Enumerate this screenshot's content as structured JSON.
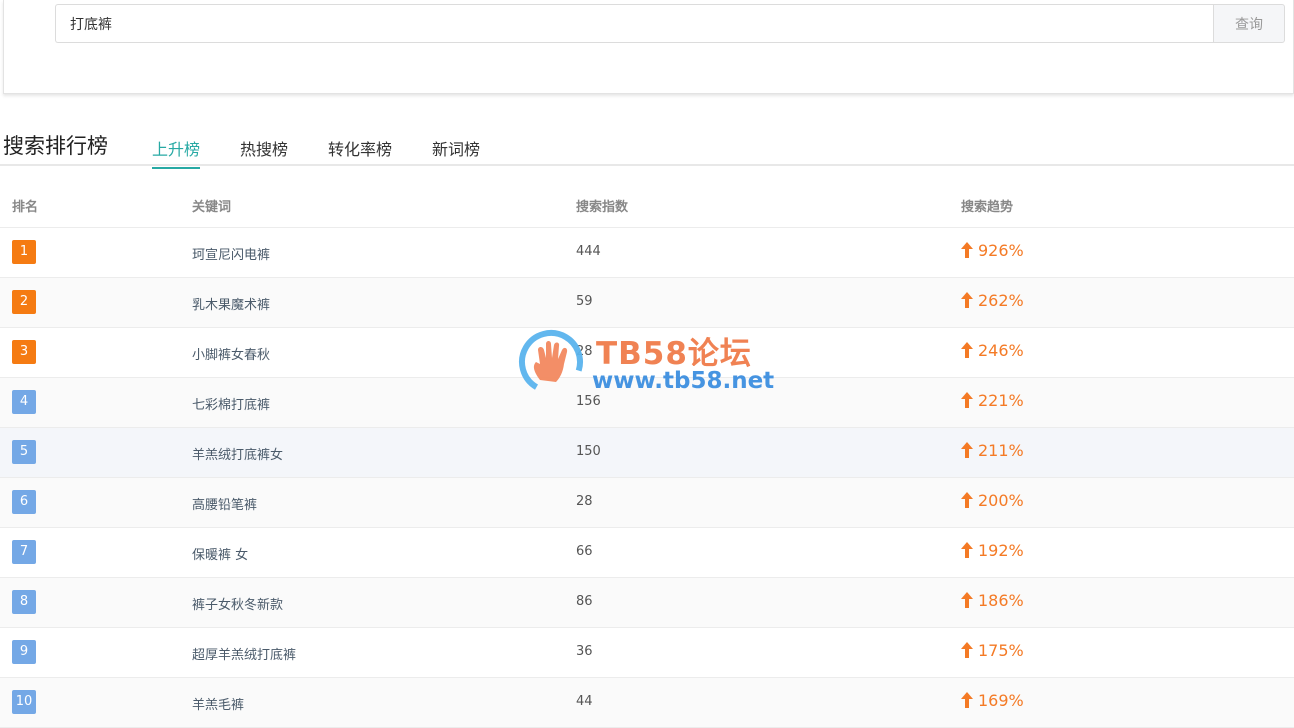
{
  "search": {
    "value": "打底裤",
    "button_label": "查询"
  },
  "ranking": {
    "title": "搜索排行榜",
    "tabs": [
      {
        "label": "上升榜",
        "active": true
      },
      {
        "label": "热搜榜",
        "active": false
      },
      {
        "label": "转化率榜",
        "active": false
      },
      {
        "label": "新词榜",
        "active": false
      }
    ],
    "columns": {
      "rank": "排名",
      "keyword": "关键词",
      "index": "搜索指数",
      "trend": "搜索趋势"
    },
    "rows": [
      {
        "rank": "1",
        "keyword": "珂宣尼闪电裤",
        "index": "444",
        "trend": "926%"
      },
      {
        "rank": "2",
        "keyword": "乳木果魔术裤",
        "index": "59",
        "trend": "262%"
      },
      {
        "rank": "3",
        "keyword": "小脚裤女春秋",
        "index": "28",
        "trend": "246%"
      },
      {
        "rank": "4",
        "keyword": "七彩棉打底裤",
        "index": "156",
        "trend": "221%"
      },
      {
        "rank": "5",
        "keyword": "羊羔绒打底裤女",
        "index": "150",
        "trend": "211%"
      },
      {
        "rank": "6",
        "keyword": "高腰铅笔裤",
        "index": "28",
        "trend": "200%"
      },
      {
        "rank": "7",
        "keyword": "保暖裤 女",
        "index": "66",
        "trend": "192%"
      },
      {
        "rank": "8",
        "keyword": "裤子女秋冬新款",
        "index": "86",
        "trend": "186%"
      },
      {
        "rank": "9",
        "keyword": "超厚羊羔绒打底裤",
        "index": "36",
        "trend": "175%"
      },
      {
        "rank": "10",
        "keyword": "羊羔毛裤",
        "index": "44",
        "trend": "169%"
      }
    ]
  },
  "watermark": {
    "brand": "TB58论坛",
    "url": "www.tb58.net"
  },
  "colors": {
    "accent": "#27a9a4",
    "top_rank_badge": "#f57b12",
    "rank_badge": "#74a8e6",
    "trend_up": "#f47a25"
  },
  "icons": {
    "trend": "arrow-up-icon",
    "logo": "hand-logo-icon"
  }
}
